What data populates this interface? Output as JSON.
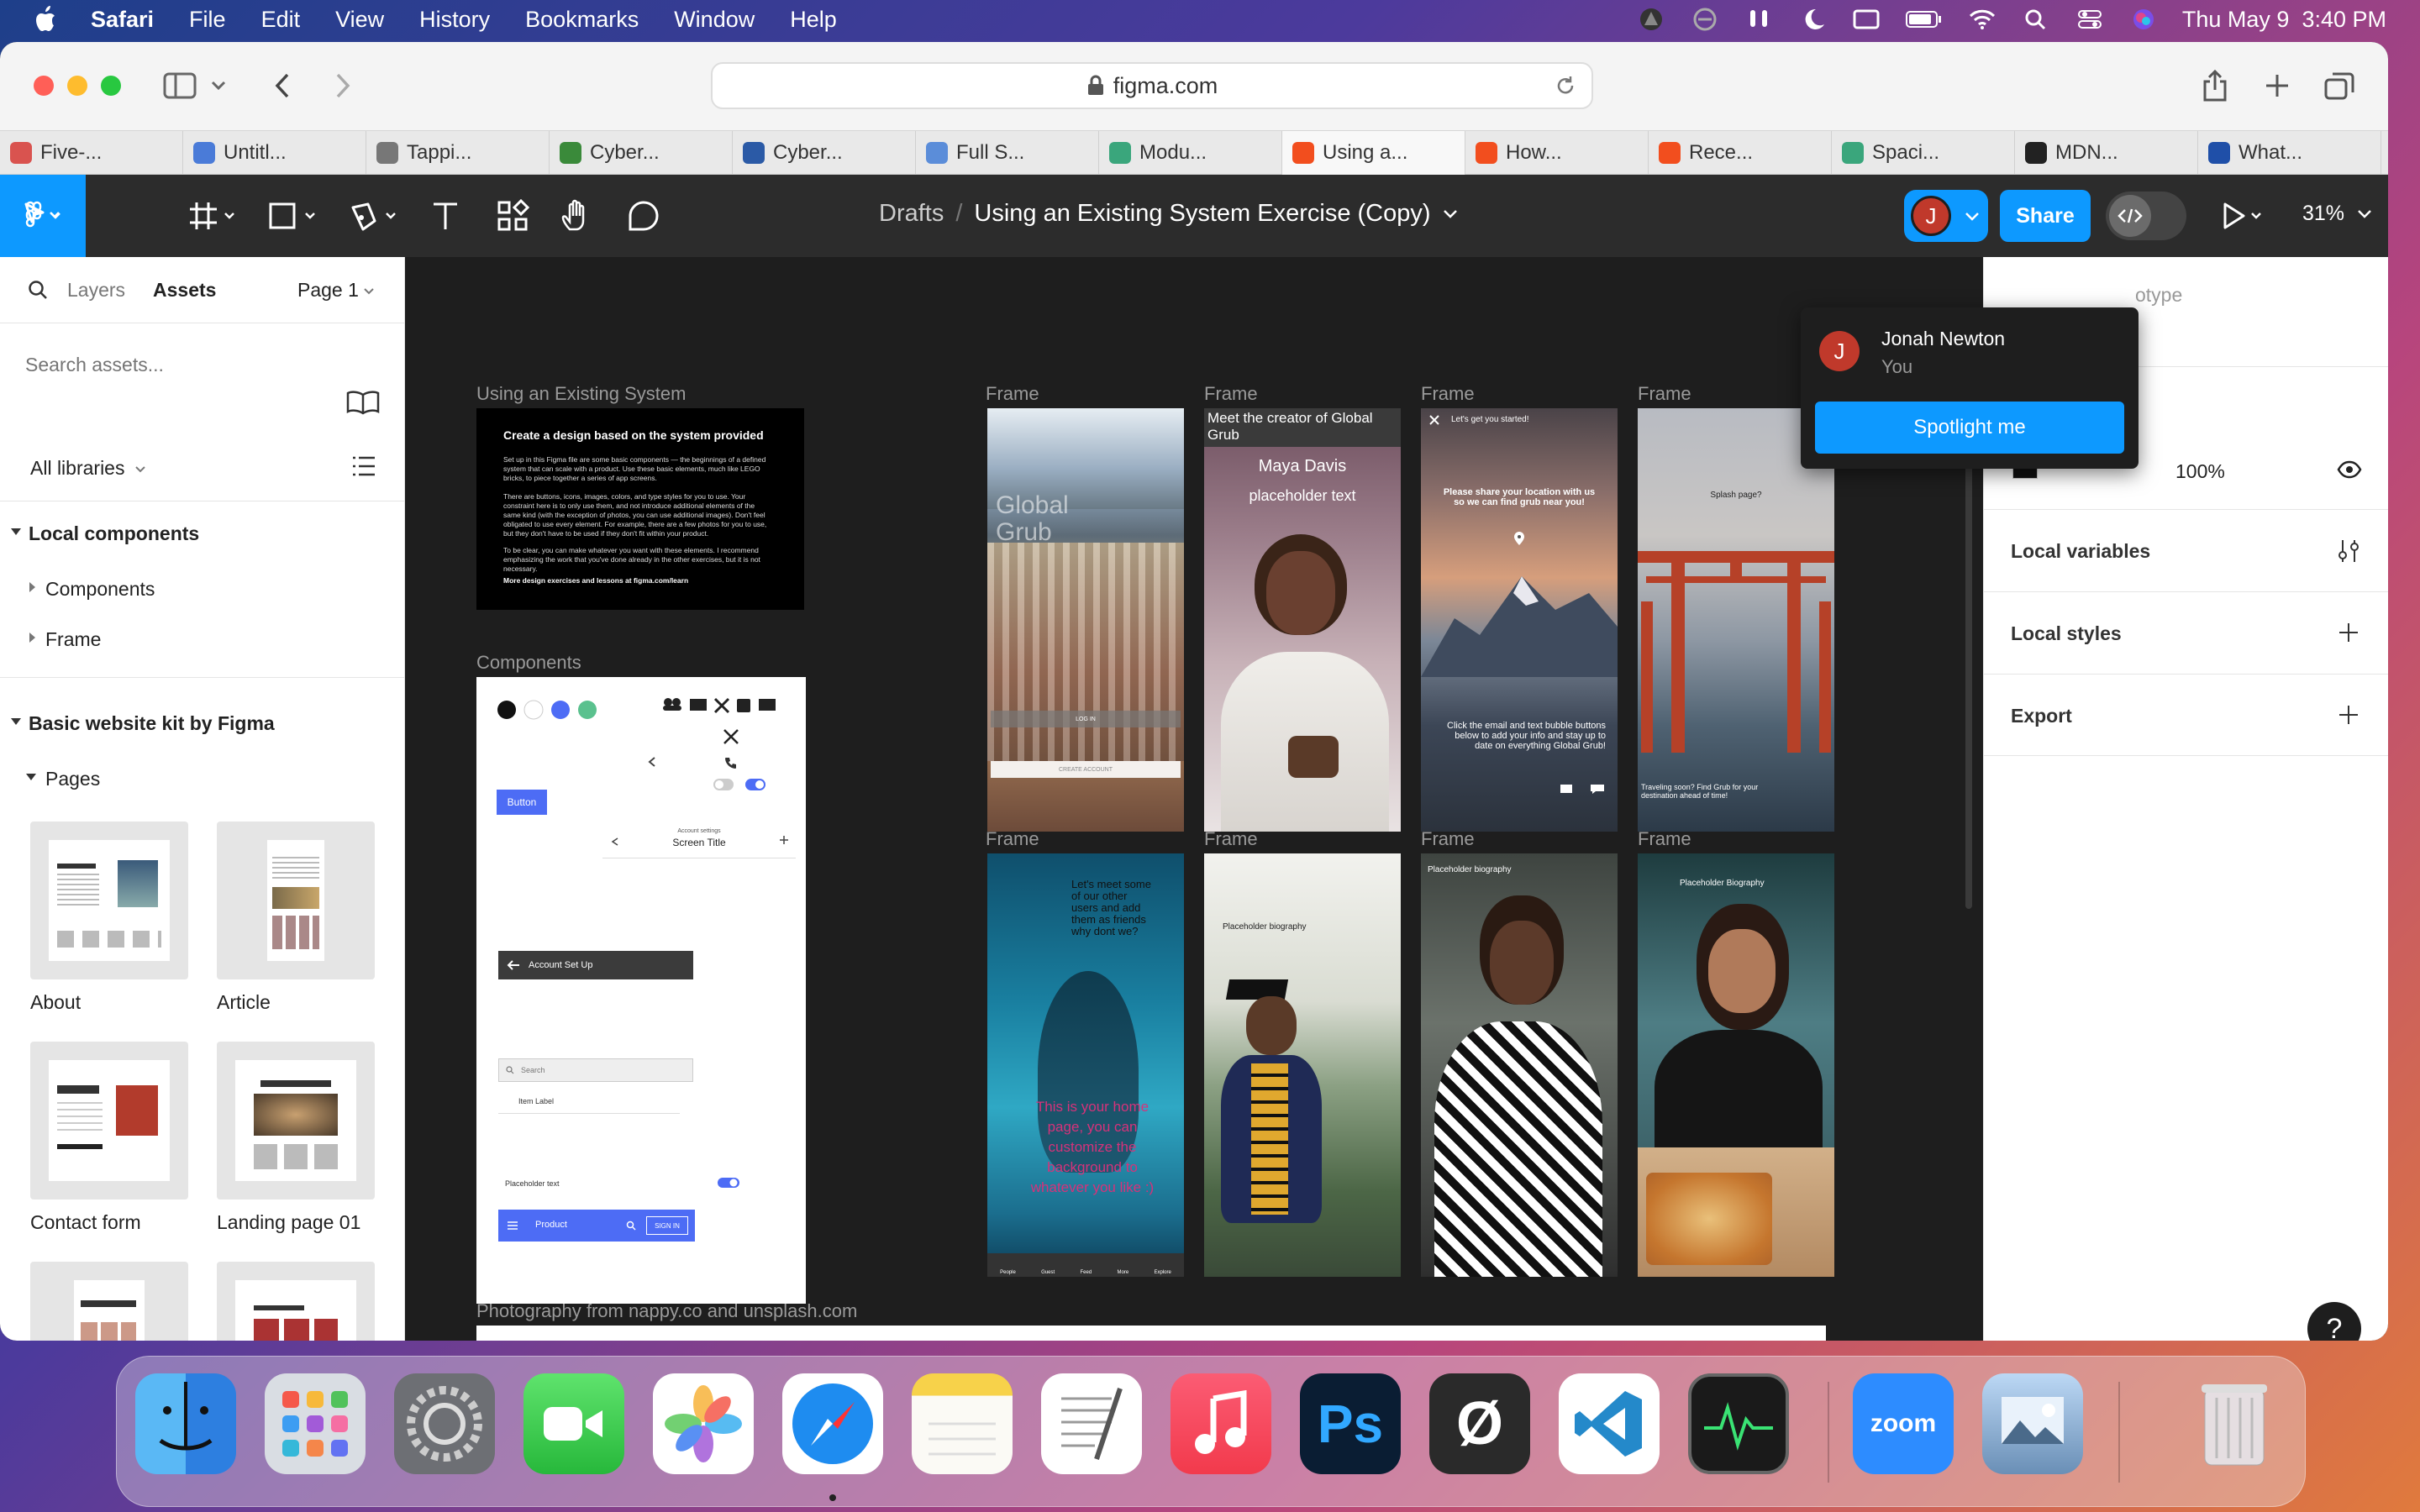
{
  "menubar": {
    "app_name": "Safari",
    "items": [
      "File",
      "Edit",
      "View",
      "History",
      "Bookmarks",
      "Window",
      "Help"
    ],
    "datetime": "Thu May 9  3:40 PM"
  },
  "browser": {
    "url": "figma.com",
    "tabs": [
      {
        "label": "Five-...",
        "color": "#d9534f"
      },
      {
        "label": "Untitl...",
        "color": "#4a7bd8"
      },
      {
        "label": "Tappi...",
        "color": "#777777"
      },
      {
        "label": "Cyber...",
        "color": "#3a8a3a"
      },
      {
        "label": "Cyber...",
        "color": "#2b5aa6"
      },
      {
        "label": "Full S...",
        "color": "#5b8dd9"
      },
      {
        "label": "Modu...",
        "color": "#3aa67c"
      },
      {
        "label": "Using a...",
        "color": "#f24e1e"
      },
      {
        "label": "How...",
        "color": "#f24e1e"
      },
      {
        "label": "Rece...",
        "color": "#f24e1e"
      },
      {
        "label": "Spaci...",
        "color": "#3aa67c"
      },
      {
        "label": "MDN...",
        "color": "#222222"
      },
      {
        "label": "What...",
        "color": "#1f4fa8"
      }
    ]
  },
  "figma": {
    "breadcrumb": {
      "folder": "Drafts",
      "separator": "/",
      "file": "Using an Existing System Exercise (Copy)"
    },
    "share_label": "Share",
    "zoom": "31%",
    "avatar_initial": "J"
  },
  "left_panel": {
    "tabs": {
      "layers": "Layers",
      "assets": "Assets"
    },
    "page_select": "Page 1",
    "search_placeholder": "Search assets...",
    "libraries": "All libraries",
    "local_components": "Local components",
    "components": "Components",
    "frame": "Frame",
    "kit": "Basic website kit by Figma",
    "pages": "Pages",
    "thumbs": [
      "About",
      "Article",
      "Contact form",
      "Landing page 01"
    ]
  },
  "canvas": {
    "title": "Using an Existing System",
    "doc_heading": "Create a design based on the system provided",
    "doc_p1": "Set up in this Figma file are some basic components — the beginnings of a defined system that can scale with a product. Use these basic elements, much like LEGO bricks, to piece together a series of app screens.",
    "doc_p2": "There are buttons, icons, images, colors, and type styles for you to use. Your constraint here is to only use them, and not introduce additional elements of the same kind (with the exception of photos, you can use additional images). Don't feel obligated to use every element. For example, there are a few photos for you to use, but they don't have to be used if they don't fit within your product.",
    "doc_p3": "To be clear, you can make whatever you want with these elements. I recommend emphasizing the work that you've done already in the other exercises, but it is not necessary.",
    "doc_link": "More design exercises and lessons at figma.com/learn",
    "components_label": "Components",
    "frame_label": "Frame",
    "comp": {
      "button": "Button",
      "account_settings": "Account settings",
      "screen_title": "Screen Title",
      "account_setup": "Account Set Up",
      "search": "Search",
      "item_label": "Item Label",
      "placeholder_text": "Placeholder text",
      "product": "Product",
      "sign_in": "SIGN IN"
    },
    "screens": {
      "s1_title": "Global Grub",
      "s1_login": "LOG IN",
      "s1_create": "CREATE ACCOUNT",
      "s2_header": "Meet the creator of Global Grub",
      "s2_name": "Maya Davis",
      "s2_sub": "placeholder text",
      "s3_top": "Let's get you started!",
      "s3_loc": "Please share your location with us so we can find grub near you!",
      "s3_bottom": "Click the email and text bubble buttons below to add your info and stay up to date on everything Global Grub!",
      "s4_title": "Splash page?",
      "s4_bottom": "Traveling soon? Find Grub for your destination ahead of time!",
      "s5_top": "Let's meet some of our other users and add them as friends why dont we?",
      "s5_bottom": "This is your home page, you can customize the background to whatever you like :)",
      "s5_nav": [
        "People",
        "Guest",
        "Feed",
        "More",
        "Explore"
      ],
      "s6_title": "Placeholder biography",
      "s7_title": "Placeholder biography",
      "s8_title": "Placeholder Biography"
    },
    "credit": "Photography from nappy.co and unsplash.com"
  },
  "right_panel": {
    "tab_partial": "otype",
    "opacity": "100%",
    "local_variables": "Local variables",
    "local_styles": "Local styles",
    "export": "Export"
  },
  "popover": {
    "name": "Jonah Newton",
    "sub": "You",
    "button": "Spotlight me"
  },
  "dock": {
    "apps": [
      "Finder",
      "Launchpad",
      "System Preferences",
      "FaceTime",
      "Photos",
      "Safari",
      "Notes",
      "TextEdit",
      "Music",
      "Photoshop",
      "Figma Agent",
      "Visual Studio Code",
      "Activity Monitor",
      "Zoom",
      "Preview",
      "Trash"
    ],
    "ps_label": "Ps",
    "zoom_label": "zoom",
    "null_label": "Ø"
  },
  "colors": {
    "figma_blue": "#0d99ff",
    "accent_indigo": "#4d6cf5",
    "avatar_red": "#c0392b"
  }
}
